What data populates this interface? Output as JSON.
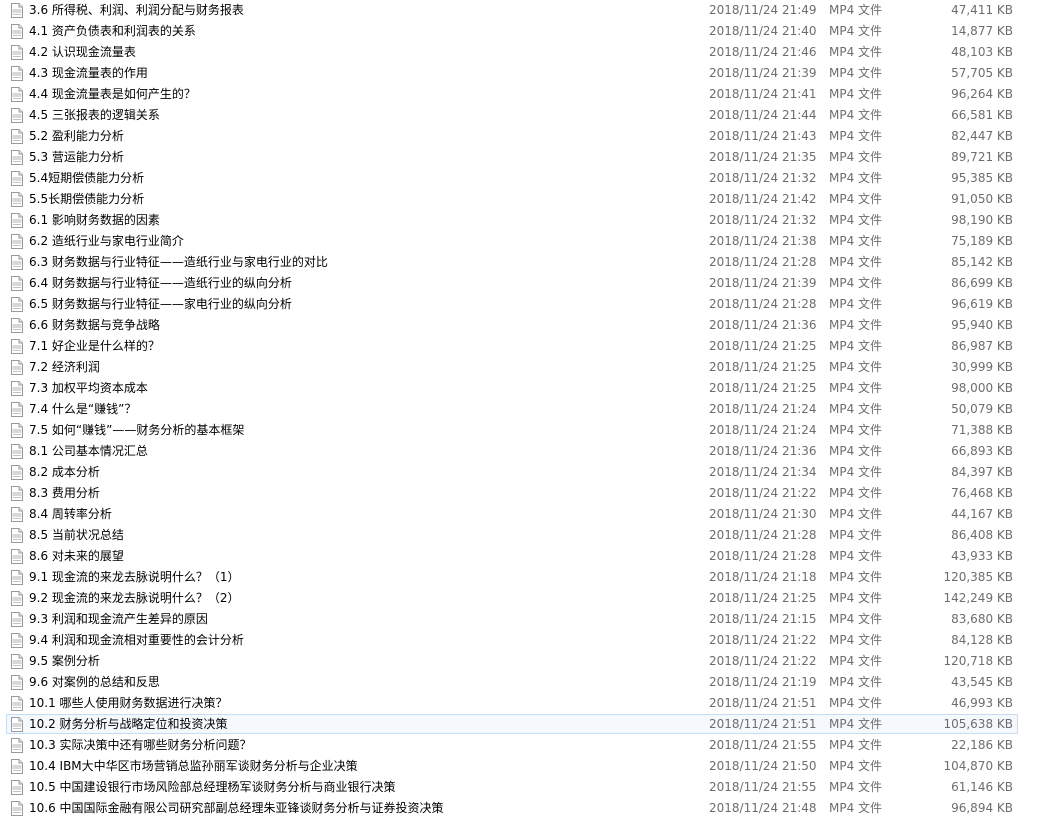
{
  "file_icon": "mp4-file-icon",
  "files": [
    {
      "name": "3.6 所得税、利润、利润分配与财务报表",
      "date": "2018/11/24 21:49",
      "type": "MP4 文件",
      "size": "47,411 KB"
    },
    {
      "name": "4.1 资产负债表和利润表的关系",
      "date": "2018/11/24 21:40",
      "type": "MP4 文件",
      "size": "14,877 KB"
    },
    {
      "name": "4.2 认识现金流量表",
      "date": "2018/11/24 21:46",
      "type": "MP4 文件",
      "size": "48,103 KB"
    },
    {
      "name": "4.3 现金流量表的作用",
      "date": "2018/11/24 21:39",
      "type": "MP4 文件",
      "size": "57,705 KB"
    },
    {
      "name": "4.4 现金流量表是如何产生的？",
      "date": "2018/11/24 21:41",
      "type": "MP4 文件",
      "size": "96,264 KB"
    },
    {
      "name": "4.5 三张报表的逻辑关系",
      "date": "2018/11/24 21:44",
      "type": "MP4 文件",
      "size": "66,581 KB"
    },
    {
      "name": "5.2 盈利能力分析",
      "date": "2018/11/24 21:43",
      "type": "MP4 文件",
      "size": "82,447 KB"
    },
    {
      "name": "5.3 营运能力分析",
      "date": "2018/11/24 21:35",
      "type": "MP4 文件",
      "size": "89,721 KB"
    },
    {
      "name": "5.4短期偿债能力分析",
      "date": "2018/11/24 21:32",
      "type": "MP4 文件",
      "size": "95,385 KB"
    },
    {
      "name": "5.5长期偿债能力分析",
      "date": "2018/11/24 21:42",
      "type": "MP4 文件",
      "size": "91,050 KB"
    },
    {
      "name": "6.1 影响财务数据的因素",
      "date": "2018/11/24 21:32",
      "type": "MP4 文件",
      "size": "98,190 KB"
    },
    {
      "name": "6.2 造纸行业与家电行业简介",
      "date": "2018/11/24 21:38",
      "type": "MP4 文件",
      "size": "75,189 KB"
    },
    {
      "name": "6.3 财务数据与行业特征——造纸行业与家电行业的对比",
      "date": "2018/11/24 21:28",
      "type": "MP4 文件",
      "size": "85,142 KB"
    },
    {
      "name": "6.4 财务数据与行业特征——造纸行业的纵向分析",
      "date": "2018/11/24 21:39",
      "type": "MP4 文件",
      "size": "86,699 KB"
    },
    {
      "name": "6.5 财务数据与行业特征——家电行业的纵向分析",
      "date": "2018/11/24 21:28",
      "type": "MP4 文件",
      "size": "96,619 KB"
    },
    {
      "name": "6.6 财务数据与竞争战略",
      "date": "2018/11/24 21:36",
      "type": "MP4 文件",
      "size": "95,940 KB"
    },
    {
      "name": "7.1 好企业是什么样的？",
      "date": "2018/11/24 21:25",
      "type": "MP4 文件",
      "size": "86,987 KB"
    },
    {
      "name": "7.2 经济利润",
      "date": "2018/11/24 21:25",
      "type": "MP4 文件",
      "size": "30,999 KB"
    },
    {
      "name": "7.3 加权平均资本成本",
      "date": "2018/11/24 21:25",
      "type": "MP4 文件",
      "size": "98,000 KB"
    },
    {
      "name": "7.4 什么是“赚钱”？",
      "date": "2018/11/24 21:24",
      "type": "MP4 文件",
      "size": "50,079 KB"
    },
    {
      "name": "7.5 如何“赚钱”——财务分析的基本框架",
      "date": "2018/11/24 21:24",
      "type": "MP4 文件",
      "size": "71,388 KB"
    },
    {
      "name": "8.1 公司基本情况汇总",
      "date": "2018/11/24 21:36",
      "type": "MP4 文件",
      "size": "66,893 KB"
    },
    {
      "name": "8.2 成本分析",
      "date": "2018/11/24 21:34",
      "type": "MP4 文件",
      "size": "84,397 KB"
    },
    {
      "name": "8.3 费用分析",
      "date": "2018/11/24 21:22",
      "type": "MP4 文件",
      "size": "76,468 KB"
    },
    {
      "name": "8.4 周转率分析",
      "date": "2018/11/24 21:30",
      "type": "MP4 文件",
      "size": "44,167 KB"
    },
    {
      "name": "8.5 当前状况总结",
      "date": "2018/11/24 21:28",
      "type": "MP4 文件",
      "size": "86,408 KB"
    },
    {
      "name": "8.6 对未来的展望",
      "date": "2018/11/24 21:28",
      "type": "MP4 文件",
      "size": "43,933 KB"
    },
    {
      "name": "9.1 现金流的来龙去脉说明什么？（1）",
      "date": "2018/11/24 21:18",
      "type": "MP4 文件",
      "size": "120,385 KB"
    },
    {
      "name": "9.2 现金流的来龙去脉说明什么？（2）",
      "date": "2018/11/24 21:25",
      "type": "MP4 文件",
      "size": "142,249 KB"
    },
    {
      "name": "9.3 利润和现金流产生差异的原因",
      "date": "2018/11/24 21:15",
      "type": "MP4 文件",
      "size": "83,680 KB"
    },
    {
      "name": "9.4 利润和现金流相对重要性的会计分析",
      "date": "2018/11/24 21:22",
      "type": "MP4 文件",
      "size": "84,128 KB"
    },
    {
      "name": "9.5 案例分析",
      "date": "2018/11/24 21:22",
      "type": "MP4 文件",
      "size": "120,718 KB"
    },
    {
      "name": "9.6 对案例的总结和反思",
      "date": "2018/11/24 21:19",
      "type": "MP4 文件",
      "size": "43,545 KB"
    },
    {
      "name": "10.1 哪些人使用财务数据进行决策？",
      "date": "2018/11/24 21:51",
      "type": "MP4 文件",
      "size": "46,993 KB"
    },
    {
      "name": "10.2 财务分析与战略定位和投资决策",
      "date": "2018/11/24 21:51",
      "type": "MP4 文件",
      "size": "105,638 KB",
      "selected": true
    },
    {
      "name": "10.3 实际决策中还有哪些财务分析问题？",
      "date": "2018/11/24 21:55",
      "type": "MP4 文件",
      "size": "22,186 KB"
    },
    {
      "name": "10.4 IBM大中华区市场营销总监孙丽军谈财务分析与企业决策",
      "date": "2018/11/24 21:50",
      "type": "MP4 文件",
      "size": "104,870 KB"
    },
    {
      "name": "10.5 中国建设银行市场风险部总经理杨军谈财务分析与商业银行决策",
      "date": "2018/11/24 21:55",
      "type": "MP4 文件",
      "size": "61,146 KB"
    },
    {
      "name": "10.6 中国国际金融有限公司研究部副总经理朱亚锋谈财务分析与证券投资决策",
      "date": "2018/11/24 21:48",
      "type": "MP4 文件",
      "size": "96,894 KB"
    }
  ]
}
